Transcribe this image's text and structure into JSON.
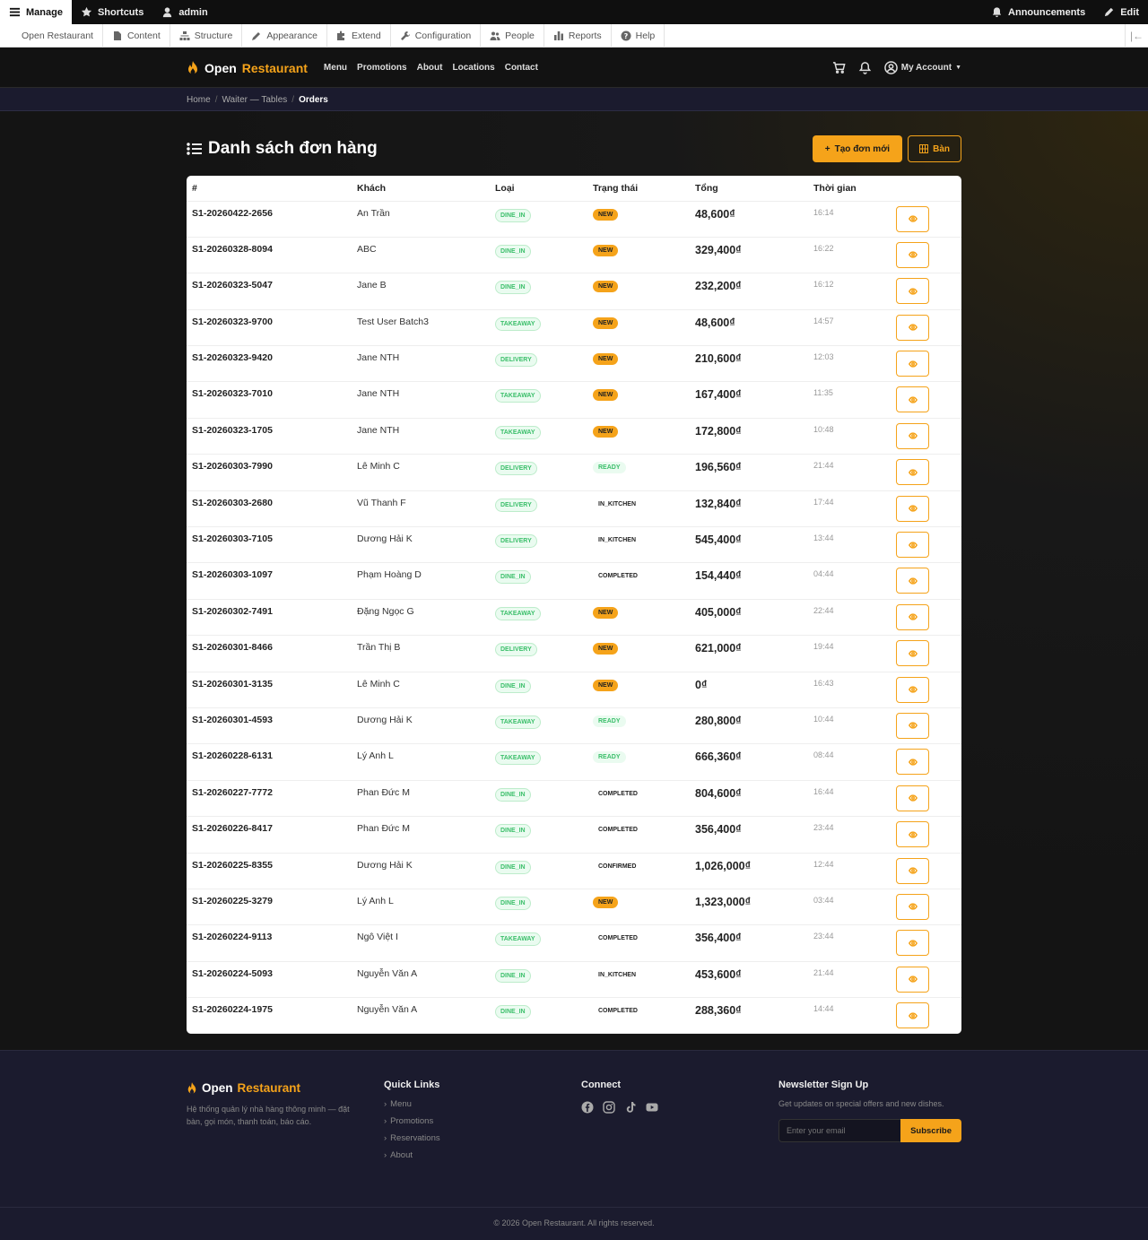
{
  "toolbar": {
    "manage": "Manage",
    "shortcuts": "Shortcuts",
    "user": "admin",
    "announcements": "Announcements",
    "edit": "Edit"
  },
  "tray": {
    "items": [
      "Open Restaurant",
      "Content",
      "Structure",
      "Appearance",
      "Extend",
      "Configuration",
      "People",
      "Reports",
      "Help"
    ]
  },
  "header": {
    "logo_open": "Open",
    "logo_restaurant": "Restaurant",
    "nav": [
      "Menu",
      "Promotions",
      "About",
      "Locations",
      "Contact"
    ],
    "account": "My Account"
  },
  "breadcrumb": {
    "home": "Home",
    "tables": "Waiter — Tables",
    "current": "Orders"
  },
  "page": {
    "title": "Danh sách đơn hàng",
    "new_order": "Tạo đơn mới",
    "tables_btn": "Bàn"
  },
  "table": {
    "headers": [
      "#",
      "Khách",
      "Loại",
      "Trạng thái",
      "Tổng",
      "Thời gian",
      ""
    ],
    "rows": [
      {
        "id": "S1-20260422-2656",
        "customer": "An Trần",
        "type": "DINE_IN",
        "status": "NEW",
        "total": "48,600₫",
        "time": "16:14"
      },
      {
        "id": "S1-20260328-8094",
        "customer": "ABC",
        "type": "DINE_IN",
        "status": "NEW",
        "total": "329,400₫",
        "time": "16:22"
      },
      {
        "id": "S1-20260323-5047",
        "customer": "Jane B",
        "type": "DINE_IN",
        "status": "NEW",
        "total": "232,200₫",
        "time": "16:12"
      },
      {
        "id": "S1-20260323-9700",
        "customer": "Test User Batch3",
        "type": "TAKEAWAY",
        "status": "NEW",
        "total": "48,600₫",
        "time": "14:57"
      },
      {
        "id": "S1-20260323-9420",
        "customer": "Jane NTH",
        "type": "DELIVERY",
        "status": "NEW",
        "total": "210,600₫",
        "time": "12:03"
      },
      {
        "id": "S1-20260323-7010",
        "customer": "Jane NTH",
        "type": "TAKEAWAY",
        "status": "NEW",
        "total": "167,400₫",
        "time": "11:35"
      },
      {
        "id": "S1-20260323-1705",
        "customer": "Jane NTH",
        "type": "TAKEAWAY",
        "status": "NEW",
        "total": "172,800₫",
        "time": "10:48"
      },
      {
        "id": "S1-20260303-7990",
        "customer": "Lê Minh C",
        "type": "DELIVERY",
        "status": "READY",
        "total": "196,560₫",
        "time": "21:44"
      },
      {
        "id": "S1-20260303-2680",
        "customer": "Vũ Thanh F",
        "type": "DELIVERY",
        "status": "IN_KITCHEN",
        "total": "132,840₫",
        "time": "17:44"
      },
      {
        "id": "S1-20260303-7105",
        "customer": "Dương Hải K",
        "type": "DELIVERY",
        "status": "IN_KITCHEN",
        "total": "545,400₫",
        "time": "13:44"
      },
      {
        "id": "S1-20260303-1097",
        "customer": "Phạm Hoàng D",
        "type": "DINE_IN",
        "status": "COMPLETED",
        "total": "154,440₫",
        "time": "04:44"
      },
      {
        "id": "S1-20260302-7491",
        "customer": "Đặng Ngọc G",
        "type": "TAKEAWAY",
        "status": "NEW",
        "total": "405,000₫",
        "time": "22:44"
      },
      {
        "id": "S1-20260301-8466",
        "customer": "Trần Thị B",
        "type": "DELIVERY",
        "status": "NEW",
        "total": "621,000₫",
        "time": "19:44"
      },
      {
        "id": "S1-20260301-3135",
        "customer": "Lê Minh C",
        "type": "DINE_IN",
        "status": "NEW",
        "total": "0₫",
        "time": "16:43"
      },
      {
        "id": "S1-20260301-4593",
        "customer": "Dương Hải K",
        "type": "TAKEAWAY",
        "status": "READY",
        "total": "280,800₫",
        "time": "10:44"
      },
      {
        "id": "S1-20260228-6131",
        "customer": "Lý Anh L",
        "type": "TAKEAWAY",
        "status": "READY",
        "total": "666,360₫",
        "time": "08:44"
      },
      {
        "id": "S1-20260227-7772",
        "customer": "Phan Đức M",
        "type": "DINE_IN",
        "status": "COMPLETED",
        "total": "804,600₫",
        "time": "16:44"
      },
      {
        "id": "S1-20260226-8417",
        "customer": "Phan Đức M",
        "type": "DINE_IN",
        "status": "COMPLETED",
        "total": "356,400₫",
        "time": "23:44"
      },
      {
        "id": "S1-20260225-8355",
        "customer": "Dương Hải K",
        "type": "DINE_IN",
        "status": "CONFIRMED",
        "total": "1,026,000₫",
        "time": "12:44"
      },
      {
        "id": "S1-20260225-3279",
        "customer": "Lý Anh L",
        "type": "DINE_IN",
        "status": "NEW",
        "total": "1,323,000₫",
        "time": "03:44"
      },
      {
        "id": "S1-20260224-9113",
        "customer": "Ngô Việt I",
        "type": "TAKEAWAY",
        "status": "COMPLETED",
        "total": "356,400₫",
        "time": "23:44"
      },
      {
        "id": "S1-20260224-5093",
        "customer": "Nguyễn Văn A",
        "type": "DINE_IN",
        "status": "IN_KITCHEN",
        "total": "453,600₫",
        "time": "21:44"
      },
      {
        "id": "S1-20260224-1975",
        "customer": "Nguyễn Văn A",
        "type": "DINE_IN",
        "status": "COMPLETED",
        "total": "288,360₫",
        "time": "14:44"
      }
    ]
  },
  "footer": {
    "logo_open": "Open",
    "logo_restaurant": "Restaurant",
    "description": "Hệ thống quản lý nhà hàng thông minh — đặt bàn, gọi món, thanh toán, báo cáo.",
    "quick_links_title": "Quick Links",
    "quick_links": [
      "Menu",
      "Promotions",
      "Reservations",
      "About"
    ],
    "connect_title": "Connect",
    "social_icons": [
      "facebook-icon",
      "instagram-icon",
      "tiktok-icon",
      "youtube-icon"
    ],
    "newsletter_title": "Newsletter Sign Up",
    "newsletter_text": "Get updates on special offers and new dishes.",
    "email_placeholder": "Enter your email",
    "subscribe": "Subscribe",
    "copyright": "© 2026 Open Restaurant. All rights reserved."
  },
  "colors": {
    "accent": "#f5a31a",
    "badge_green": "#3bbf6a"
  }
}
